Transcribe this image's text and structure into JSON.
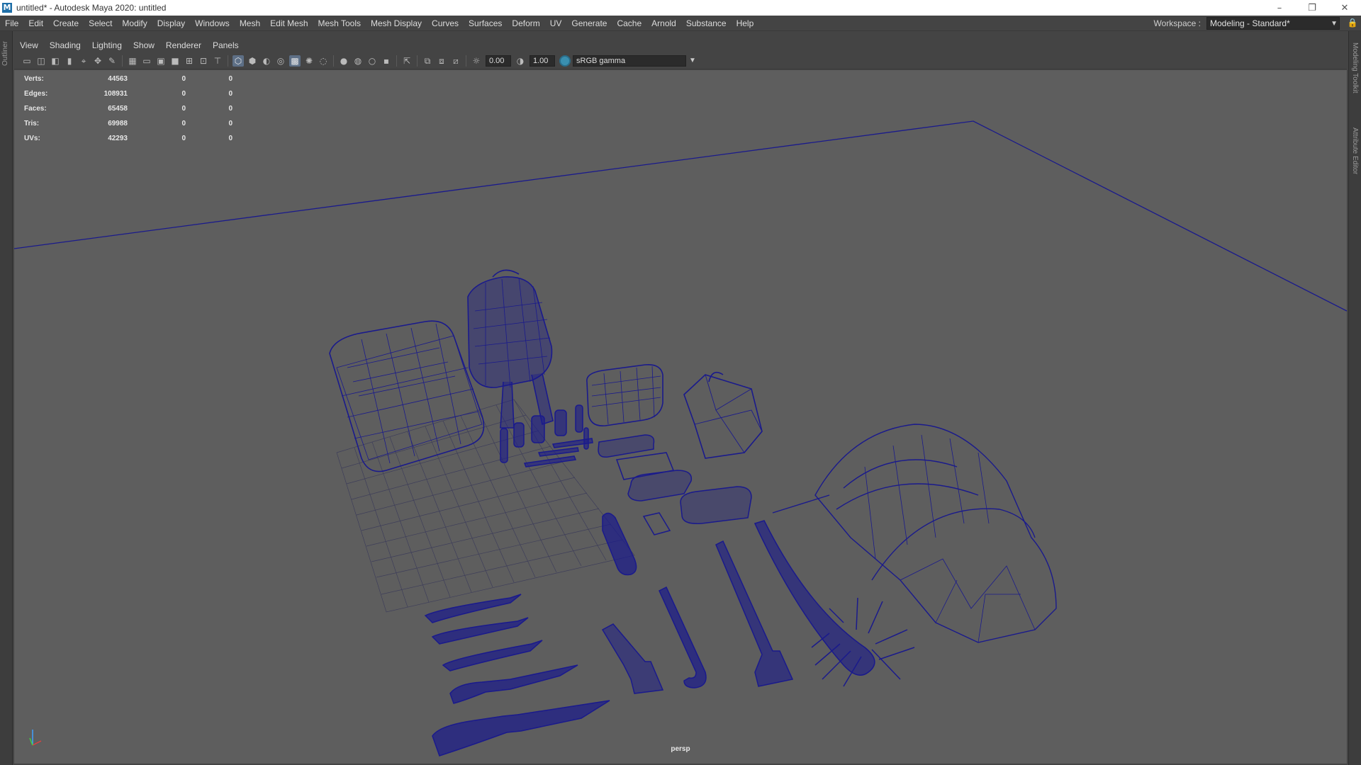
{
  "window": {
    "title": "untitled* - Autodesk Maya 2020: untitled",
    "logo_letter": "M",
    "buttons": {
      "minimize": "–",
      "restore": "❐",
      "close": "✕"
    }
  },
  "menubar": {
    "items": [
      "File",
      "Edit",
      "Create",
      "Select",
      "Modify",
      "Display",
      "Windows",
      "Mesh",
      "Edit Mesh",
      "Mesh Tools",
      "Mesh Display",
      "Curves",
      "Surfaces",
      "Deform",
      "UV",
      "Generate",
      "Cache",
      "Arnold",
      "Substance",
      "Help"
    ],
    "workspace_label": "Workspace :",
    "workspace_value": "Modeling - Standard*"
  },
  "left_tabs": {
    "outliner": "Outliner"
  },
  "right_tabs": {
    "modeling_toolkit": "Modeling Toolkit",
    "attribute_editor": "Attribute Editor"
  },
  "panel_menu": [
    "View",
    "Shading",
    "Lighting",
    "Show",
    "Renderer",
    "Panels"
  ],
  "toolbar": {
    "exposure": "0.00",
    "gamma": "1.00",
    "colorspace": "sRGB gamma"
  },
  "hud": {
    "rows": [
      {
        "label": "Verts:",
        "v1": "44563",
        "v2": "0",
        "v3": "0"
      },
      {
        "label": "Edges:",
        "v1": "108931",
        "v2": "0",
        "v3": "0"
      },
      {
        "label": "Faces:",
        "v1": "65458",
        "v2": "0",
        "v3": "0"
      },
      {
        "label": "Tris:",
        "v1": "69988",
        "v2": "0",
        "v3": "0"
      },
      {
        "label": "UVs:",
        "v1": "42293",
        "v2": "0",
        "v3": "0"
      }
    ]
  },
  "viewport": {
    "camera": "persp",
    "wire_color": "#1a1a8c",
    "bg_color": "#5e5e5e"
  }
}
